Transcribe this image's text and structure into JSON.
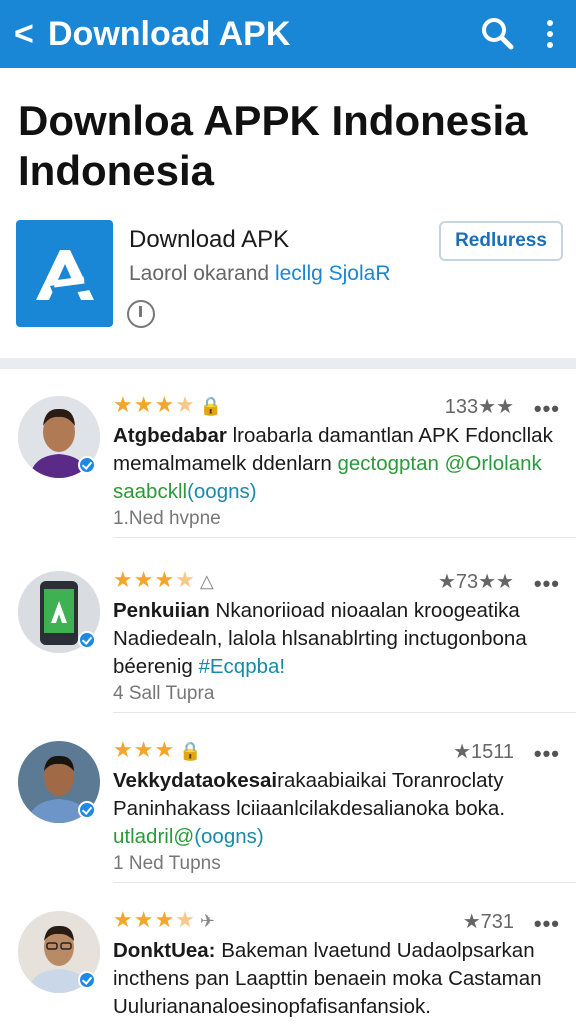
{
  "appbar": {
    "back_glyph": "<",
    "title": "Download APK",
    "search_icon": "search-icon",
    "menu_icon": "more-vertical-icon",
    "color": "#1a86d6"
  },
  "headline": "Downloa APPK Indonesia Indonesia",
  "app": {
    "name": "Download APK",
    "subtitle_plain": "Laorol okarand ",
    "subtitle_highlight": "lecllg SjolaR",
    "button_label": "Redluress",
    "icon": "android-a-icon"
  },
  "reviews": [
    {
      "stars": "★★★",
      "stars_dim": "★",
      "tag": "🔒",
      "meta": "133★★",
      "author": "Atgbedabar",
      "text": " lroabarla damantlan APK Fdoncllak memalmamelk ddenlarn ",
      "green": "gectogptan @Orlolank",
      "teal_line_green": "saabckll",
      "teal": "(oogns)",
      "footer": "1.Ned hvpne"
    },
    {
      "stars": "★★★",
      "stars_dim": "★",
      "tag": "△",
      "meta": "★73★★",
      "author": "Penkuiian",
      "text": " Nkanoriioad nioaalan kroogeatika Nadiedealn, lalola hlsanablrting inctugonbona béerenig ",
      "green": "",
      "teal_line_green": "",
      "teal": "#Ecqpba!",
      "footer": "4 Sall Tupra"
    },
    {
      "stars": "★★★",
      "stars_dim": "",
      "tag": "🔒",
      "meta": "★1511",
      "author": "Vekkydataokesai",
      "text": "rakaabiaikai Toranroclaty Paninhakass lciiaanlcilakdesalianoka boka. ",
      "green": "",
      "teal_line_green": "utladril@",
      "teal": "(oogns)",
      "footer": "1 Ned Tupns"
    },
    {
      "stars": "★★★",
      "stars_dim": "★",
      "tag": "✈",
      "meta": "★731",
      "author": "DonktUea:",
      "text": " Bakeman lvaetund Uadaolpsarkan incthens pan Laapttin benaein moka Castaman Uuluriananaloesinopfafisanfansiok.",
      "green": "",
      "teal_line_green": "",
      "teal": "",
      "footer": ""
    }
  ]
}
